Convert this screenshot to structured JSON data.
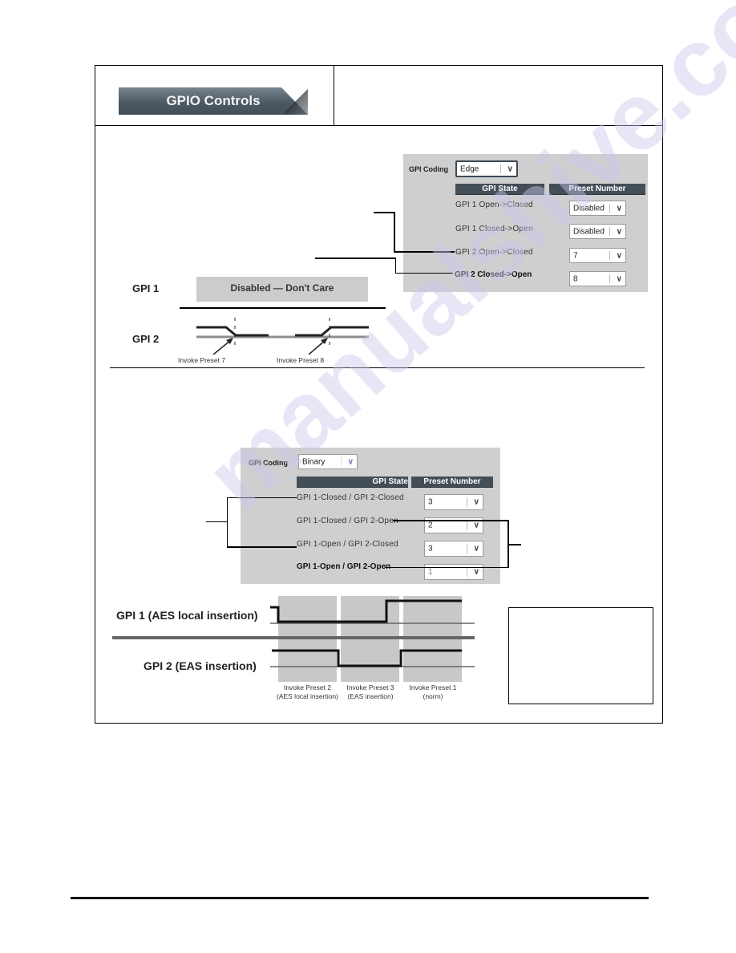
{
  "header": {
    "tab_label": "GPIO Controls"
  },
  "edge_section": {
    "panel": {
      "coding_label": "GPI Coding",
      "coding_value": "Edge",
      "col_state": "GPI State",
      "col_preset": "Preset Number",
      "rows": [
        {
          "state": "GPI 1 Open->Closed",
          "preset": "Disabled"
        },
        {
          "state": "GPI 1 Closed->Open",
          "preset": "Disabled"
        },
        {
          "state": "GPI 2 Open->Closed",
          "preset": "7"
        },
        {
          "state": "GPI 2 Closed->Open",
          "preset": "8"
        }
      ]
    },
    "diagram": {
      "gpi1_label": "GPI 1",
      "gpi1_box": "Disabled — Don't Care",
      "gpi2_label": "GPI 2",
      "annot1": "Invoke Preset 7",
      "annot2": "Invoke Preset 8"
    }
  },
  "binary_section": {
    "panel": {
      "coding_label": "GPI Coding",
      "coding_value": "Binary",
      "col_state": "GPI State",
      "col_preset": "Preset Number",
      "rows": [
        {
          "state": "GPI 1-Closed / GPI 2-Closed",
          "preset": "3"
        },
        {
          "state": "GPI 1-Closed / GPI 2-Open",
          "preset": "2"
        },
        {
          "state": "GPI 1-Open / GPI 2-Closed",
          "preset": "3"
        },
        {
          "state": "GPI 1-Open / GPI 2-Open",
          "preset": "1"
        }
      ]
    },
    "diagram": {
      "gpi1_label": "GPI 1 (AES local insertion)",
      "gpi2_label": "GPI 2 (EAS insertion)",
      "windows": [
        {
          "line1": "Invoke Preset 2",
          "line2": "(AES local insertion)"
        },
        {
          "line1": "Invoke Preset 3",
          "line2": "(EAS insertion)"
        },
        {
          "line1": "Invoke Preset 1",
          "line2": "(norm)"
        }
      ]
    }
  },
  "watermark": "manualshive.com",
  "icons": {
    "dropdown": "∨"
  }
}
